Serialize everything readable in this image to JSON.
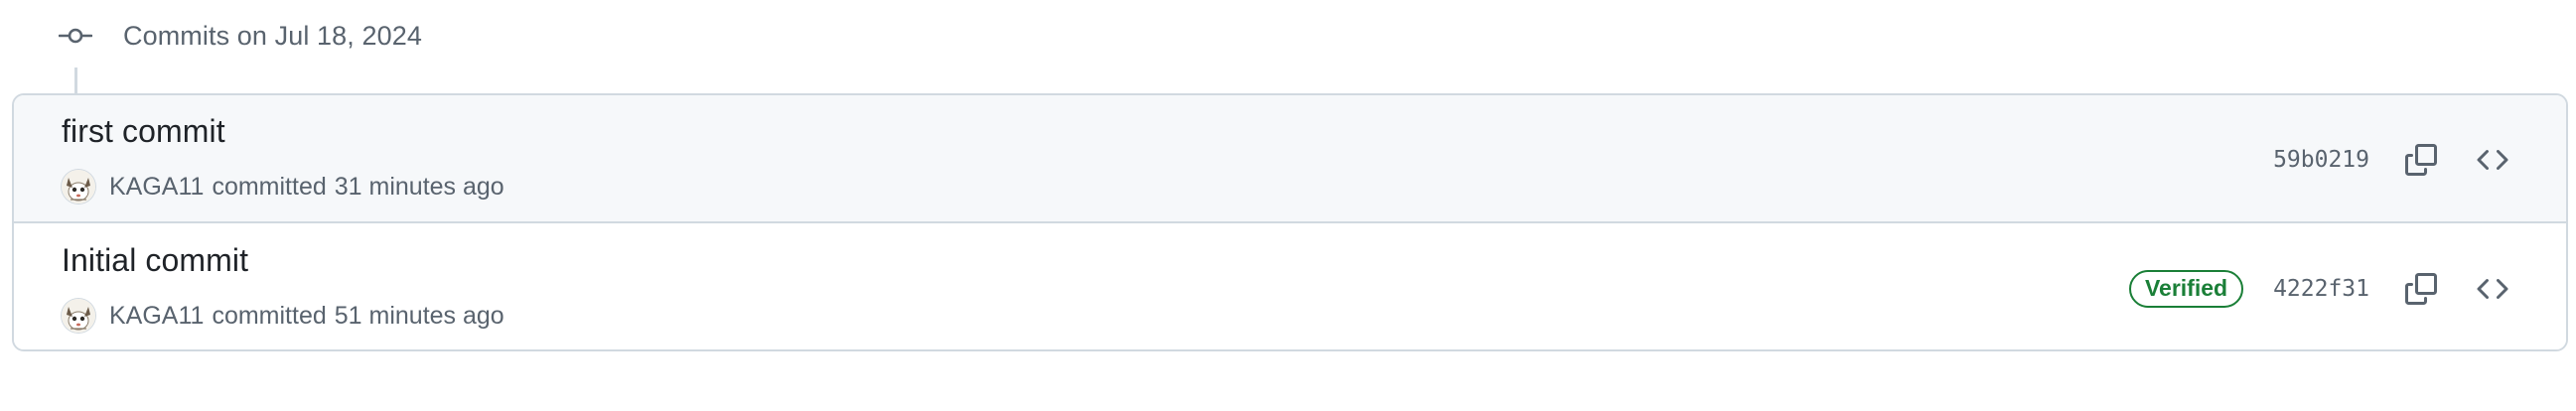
{
  "timeline": {
    "date_heading": "Commits on Jul 18, 2024",
    "icon": "git-commit-icon"
  },
  "commits": [
    {
      "title": "first commit",
      "author": "KAGA11",
      "verb": "committed",
      "time": "31 minutes ago",
      "verified": false,
      "sha": "59b0219",
      "copy_icon": "copy-icon",
      "browse_icon": "code-icon"
    },
    {
      "title": "Initial commit",
      "author": "KAGA11",
      "verb": "committed",
      "time": "51 minutes ago",
      "verified": true,
      "verified_label": "Verified",
      "sha": "4222f31",
      "copy_icon": "copy-icon",
      "browse_icon": "code-icon"
    }
  ],
  "colors": {
    "border": "#d1d9e0",
    "muted_text": "#59636e",
    "primary_text": "#1f2328",
    "verified_green": "#1a7f37",
    "row_highlight": "#f6f8fa"
  }
}
